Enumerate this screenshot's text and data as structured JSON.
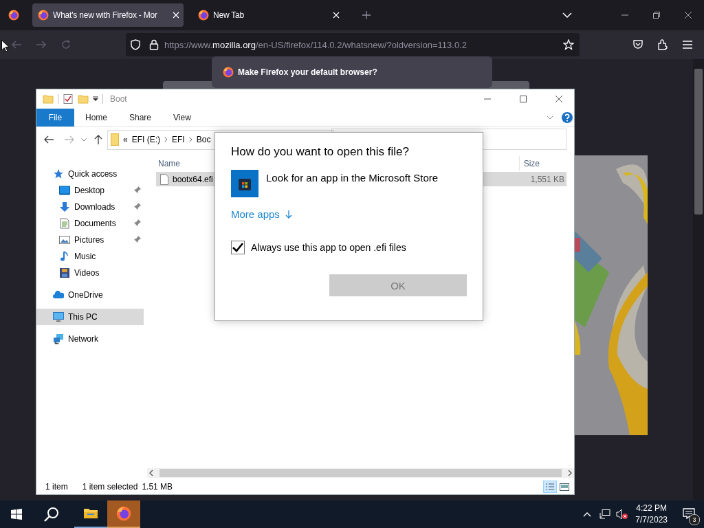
{
  "browser": {
    "tabs": [
      {
        "title": "What's new with Firefox - Mor",
        "selected": true
      },
      {
        "title": "New Tab",
        "selected": false
      }
    ],
    "url": {
      "prefix": "https://www.",
      "domain": "mozilla.org",
      "path": "/en-US/firefox/114.0.2/whatsnew/?oldversion=113.0.2"
    },
    "notification": "Make Firefox your default browser?"
  },
  "explorer": {
    "title": "Boot",
    "ribbon_tabs": [
      {
        "label": "File",
        "selected": true
      },
      {
        "label": "Home",
        "selected": false
      },
      {
        "label": "Share",
        "selected": false
      },
      {
        "label": "View",
        "selected": false
      }
    ],
    "breadcrumb": {
      "overflow": "«",
      "parts": [
        "EFI (E:)",
        "EFI",
        "Boc"
      ]
    },
    "nav": [
      {
        "label": "Quick access",
        "kind": "star",
        "selected": false,
        "children": [
          {
            "label": "Desktop",
            "kind": "desktop",
            "pinned": true,
            "selected": false
          },
          {
            "label": "Downloads",
            "kind": "downloads",
            "pinned": true,
            "selected": false
          },
          {
            "label": "Documents",
            "kind": "documents",
            "pinned": true,
            "selected": false
          },
          {
            "label": "Pictures",
            "kind": "pictures",
            "pinned": true,
            "selected": false
          },
          {
            "label": "Music",
            "kind": "music",
            "pinned": false,
            "selected": false
          },
          {
            "label": "Videos",
            "kind": "videos",
            "pinned": false,
            "selected": false
          }
        ]
      },
      {
        "label": "OneDrive",
        "kind": "cloud",
        "selected": false
      },
      {
        "label": "This PC",
        "kind": "computer",
        "selected": true
      },
      {
        "label": "Network",
        "kind": "network",
        "selected": false
      }
    ],
    "columns": [
      "Name",
      "Size"
    ],
    "files": [
      {
        "name": "bootx64.efi",
        "size": "1,551 KB",
        "selected": true
      }
    ],
    "status": {
      "count": "1 item",
      "selection": "1 item selected",
      "size": "1.51 MB"
    }
  },
  "dialog": {
    "title": "How do you want to open this file?",
    "option": "Look for an app in the Microsoft Store",
    "more_link": "More apps",
    "checkbox": {
      "label": "Always use this app to open .efi files",
      "checked": true
    },
    "button": {
      "label": "OK",
      "disabled": true
    }
  },
  "taskbar": {
    "apps": [
      {
        "kind": "file-explorer",
        "selected": false
      },
      {
        "kind": "browser",
        "selected": true
      }
    ],
    "time": "4:22 PM",
    "date": "7/7/2023",
    "notifications": "3"
  }
}
